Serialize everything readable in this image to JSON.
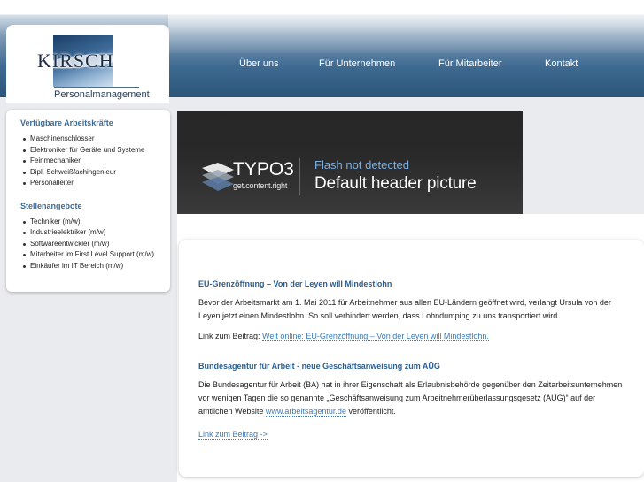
{
  "logo": {
    "name": "KIRSCH",
    "subtitle": "Personalmanagement"
  },
  "nav": {
    "items": [
      "Über uns",
      "Für Unternehmen",
      "Für Mitarbeiter",
      "Kontakt"
    ]
  },
  "sidebar": {
    "section1": {
      "title": "Verfügbare Arbeitskräfte",
      "items": [
        "Maschinenschlosser",
        "Elektroniker für Geräte und Systeme",
        "Feinmechaniker",
        "Dipl. Schweißfachingenieur",
        "Personalleiter"
      ]
    },
    "section2": {
      "title": "Stellenangebote",
      "items": [
        "Techniker (m/w)",
        "Industrieelektriker (m/w)",
        "Softwareentwickler (m/w)",
        "Mitarbeiter im First Level Support (m/w)",
        "Einkäufer im IT Bereich (m/w)"
      ]
    }
  },
  "banner": {
    "brand": "TYPO3",
    "slogan": "get.content.right",
    "flash_note": "Flash not detected",
    "title": "Default header picture"
  },
  "articles": [
    {
      "title": "EU-Grenzöffnung – Von der Leyen will Mindestlohn",
      "body": "Bevor der Arbeitsmarkt am 1. Mai 2011 für Arbeitnehmer aus allen EU-Ländern geöffnet wird, verlangt Ursula von der Leyen jetzt einen Mindestlohn. So soll verhindert werden, dass Lohndumping zu uns transportiert wird.",
      "link_prefix": "Link zum Beitrag:",
      "link_text": "Welt online: EU-Grenzöffnung – Von der Leyen will Mindestlohn."
    },
    {
      "title": "Bundesagentur für Arbeit - neue Geschäftsanweisung zum AÜG",
      "body": "Die Bundesagentur für Arbeit (BA) hat in ihrer Eigenschaft als Erlaubnisbehörde gegenüber den Zeitarbeitsunternehmen vor wenigen Tagen die so genannte „Geschäftsanweisung zum Arbeitnehmerüberlassungsgesetz (AÜG)“ auf der amtlichen Website",
      "inline_link": "www.arbeitsagentur.de",
      "body_suffix": "veröffentlicht.",
      "link_text": "Link zum Beitrag ->"
    }
  ],
  "colors": {
    "accent": "#3c6b98",
    "link": "#3a7bb8",
    "header_dark": "#2b5579"
  }
}
